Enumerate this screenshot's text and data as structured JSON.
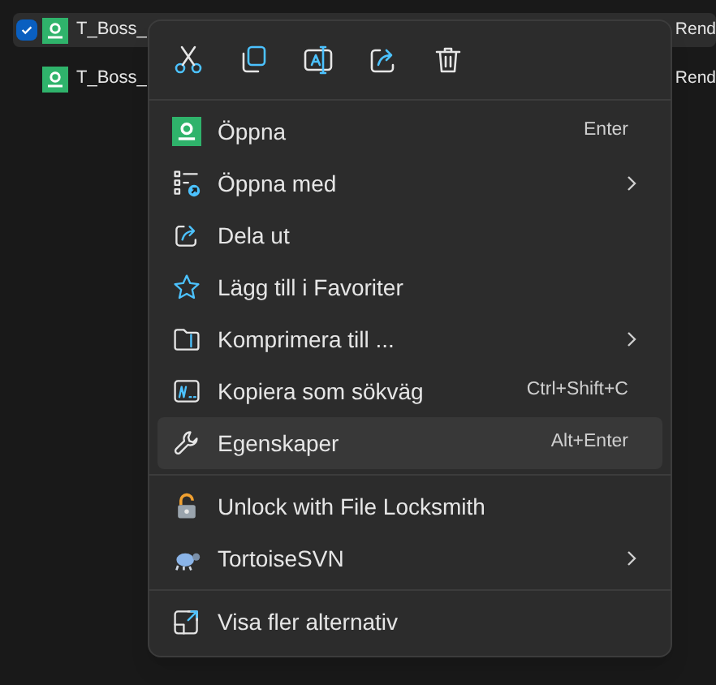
{
  "files": [
    {
      "name": "T_Boss_",
      "selected": true,
      "column_2": "Rend"
    },
    {
      "name": "T_Boss_",
      "selected": false,
      "column_2": "Rend"
    }
  ],
  "context_menu": {
    "toolbar": [
      {
        "kind": "cut"
      },
      {
        "kind": "copy"
      },
      {
        "kind": "rename"
      },
      {
        "kind": "share"
      },
      {
        "kind": "delete"
      }
    ],
    "groups": [
      [
        {
          "kind": "app",
          "label": "Öppna",
          "shortcut": "Enter",
          "submenu": false,
          "selected": false
        },
        {
          "kind": "openwith",
          "label": "Öppna med",
          "submenu": true,
          "selected": false
        },
        {
          "kind": "share",
          "label": "Dela ut",
          "submenu": false,
          "selected": false
        },
        {
          "kind": "star",
          "label": "Lägg till i Favoriter",
          "submenu": false,
          "selected": false
        },
        {
          "kind": "zip",
          "label": "Komprimera till ...",
          "submenu": true,
          "selected": false
        },
        {
          "kind": "path",
          "label": "Kopiera som sökväg",
          "shortcut": "Ctrl+Shift+C",
          "submenu": false,
          "selected": false
        },
        {
          "kind": "wrench",
          "label": "Egenskaper",
          "shortcut": "Alt+Enter",
          "submenu": false,
          "selected": true
        }
      ],
      [
        {
          "kind": "lock",
          "label": "Unlock with File Locksmith",
          "submenu": false,
          "selected": false
        },
        {
          "kind": "turtle",
          "label": "TortoiseSVN",
          "submenu": true,
          "selected": false
        }
      ],
      [
        {
          "kind": "more",
          "label": "Visa fler alternativ",
          "submenu": false,
          "selected": false
        }
      ]
    ]
  }
}
